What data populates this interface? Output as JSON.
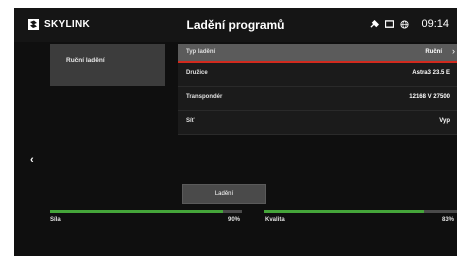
{
  "header": {
    "brand": "SKYLINK",
    "title": "Ladění programů",
    "time": "09:14"
  },
  "left_menu": {
    "item": "Ruční ladění"
  },
  "rows": [
    {
      "label": "Typ ladění",
      "value": "Ruční"
    },
    {
      "label": "Družice",
      "value": "Astra3 23.5 E"
    },
    {
      "label": "Transpondér",
      "value": "12168 V 27500"
    },
    {
      "label": "Síť",
      "value": "Vyp"
    }
  ],
  "tune_button": "Ladění",
  "signal": {
    "strength_label": "Síla",
    "strength_value": "90%",
    "strength": 0.9,
    "quality_label": "Kvalita",
    "quality_value": "83%",
    "quality": 0.83
  },
  "colors": {
    "accent": "#d22a1e",
    "bar_fill": "#45a53a"
  },
  "icons": {
    "back": "chevron-left-icon",
    "expand": "chevron-right-icon"
  }
}
